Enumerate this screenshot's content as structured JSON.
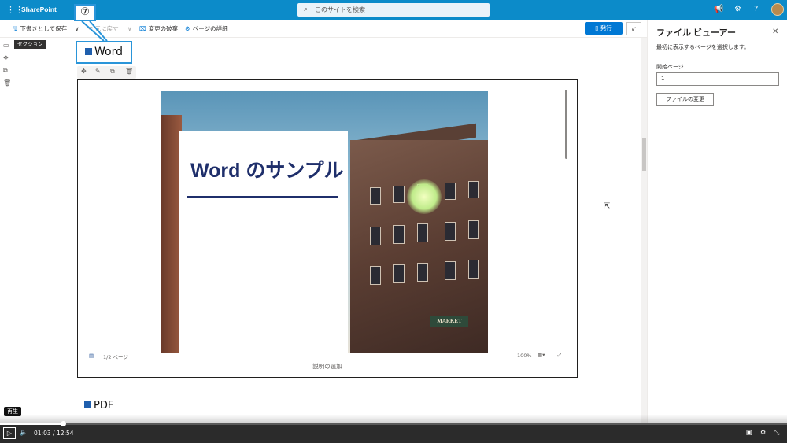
{
  "topbar": {
    "brand": "SharePoint",
    "search_placeholder": "このサイトを検索",
    "icons": [
      "waffle-icon",
      "megaphone-icon",
      "gear-icon",
      "help-icon",
      "avatar"
    ]
  },
  "commandbar": {
    "save_draft": "下書きとして保存",
    "undo": "元に戻す",
    "discard": "変更の破棄",
    "page_details": "ページの詳細",
    "publish": "発行"
  },
  "section_label": "セクション",
  "callout": {
    "number": "⑦",
    "word_label": "Word"
  },
  "viewer": {
    "doc_title": "Word のサンプル",
    "market_sign": "MARKET",
    "page_indicator": "1/2 ページ",
    "zoom": "100%",
    "caption": "説明の追加"
  },
  "pdf_label": "PDF",
  "panel": {
    "title": "ファイル ビューアー",
    "description": "最初に表示するページを選択します。",
    "start_page_label": "開始ページ",
    "start_page_value": "1",
    "change_file_button": "ファイルの変更"
  },
  "player": {
    "tooltip": "再生",
    "current_time": "01:03",
    "separator": "/",
    "total_time": "12:54",
    "progress_fraction": 0.081
  },
  "colors": {
    "topbar": "#0c8bc9",
    "accent": "#0078d4",
    "callout_border": "#2a95d9",
    "doc_title": "#1f2f6b"
  }
}
